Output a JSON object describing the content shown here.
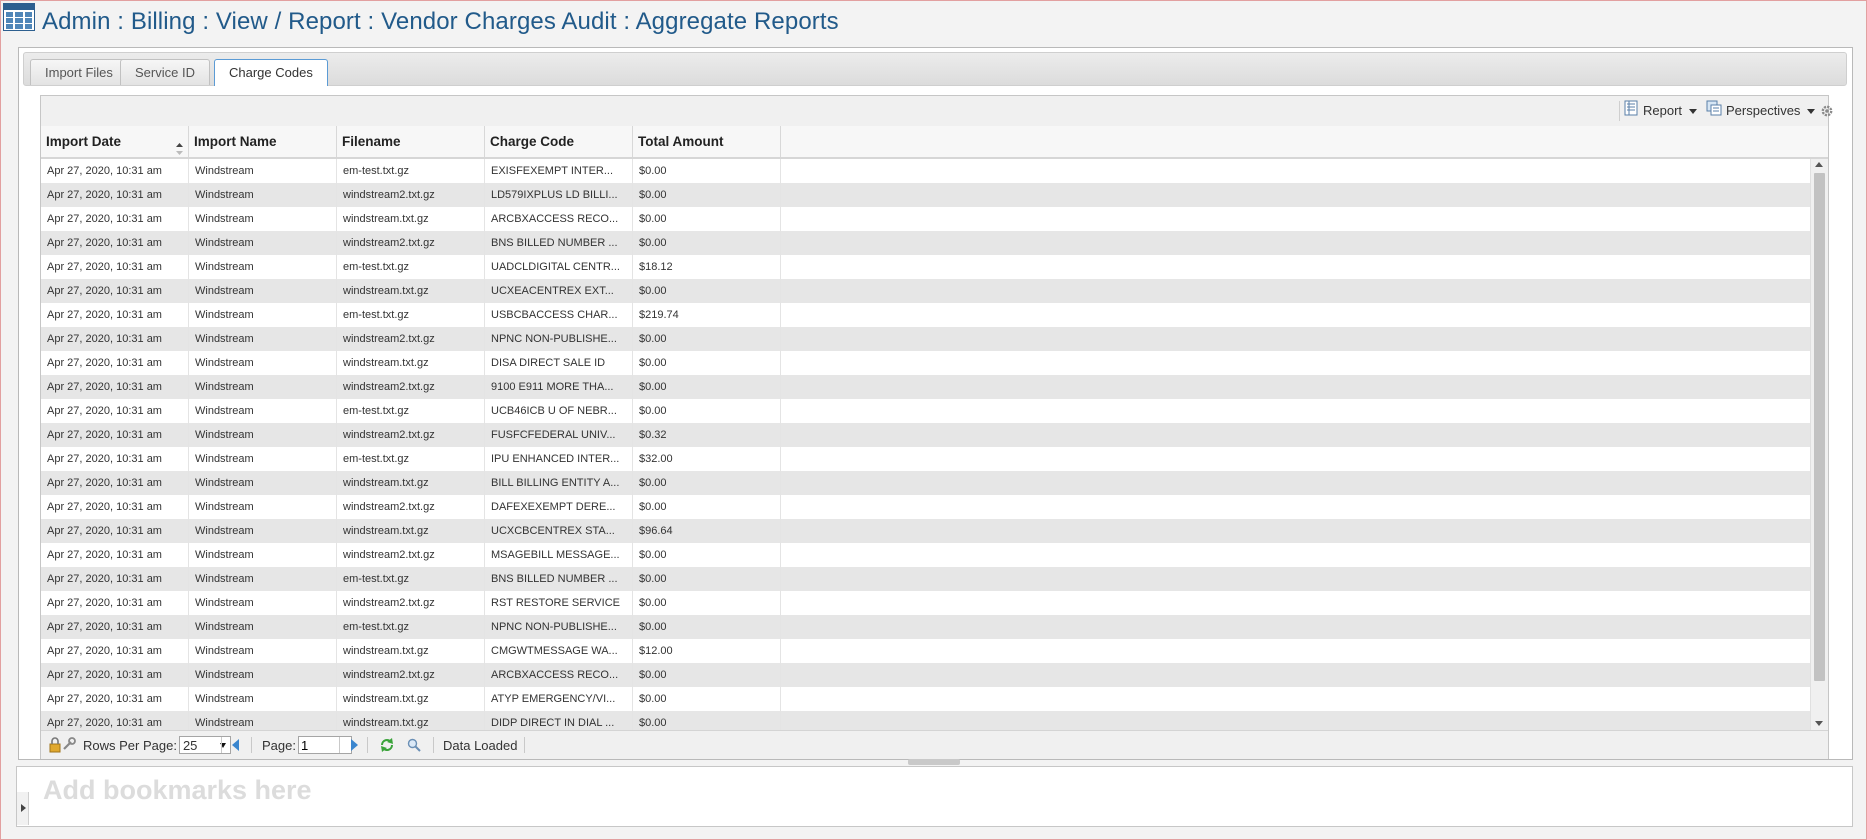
{
  "page_title": "Admin : Billing : View / Report : Vendor Charges Audit : Aggregate Reports",
  "tabs": [
    {
      "label": "Import Files",
      "active": false
    },
    {
      "label": "Service ID",
      "active": false
    },
    {
      "label": "Charge Codes",
      "active": true
    }
  ],
  "toolbar": {
    "report_label": "Report",
    "perspectives_label": "Perspectives"
  },
  "columns": [
    "Import Date",
    "Import Name",
    "Filename",
    "Charge Code",
    "Total Amount"
  ],
  "sorted_column": "Import Date",
  "rows": [
    [
      "Apr 27, 2020, 10:31 am",
      "Windstream",
      "em-test.txt.gz",
      "EXISFEXEMPT INTER...",
      "$0.00"
    ],
    [
      "Apr 27, 2020, 10:31 am",
      "Windstream",
      "windstream2.txt.gz",
      "LD579IXPLUS LD BILLI...",
      "$0.00"
    ],
    [
      "Apr 27, 2020, 10:31 am",
      "Windstream",
      "windstream.txt.gz",
      "ARCBXACCESS RECO...",
      "$0.00"
    ],
    [
      "Apr 27, 2020, 10:31 am",
      "Windstream",
      "windstream2.txt.gz",
      "BNS BILLED NUMBER ...",
      "$0.00"
    ],
    [
      "Apr 27, 2020, 10:31 am",
      "Windstream",
      "em-test.txt.gz",
      "UADCLDIGITAL CENTR...",
      "$18.12"
    ],
    [
      "Apr 27, 2020, 10:31 am",
      "Windstream",
      "windstream.txt.gz",
      "UCXEACENTREX EXT...",
      "$0.00"
    ],
    [
      "Apr 27, 2020, 10:31 am",
      "Windstream",
      "em-test.txt.gz",
      "USBCBACCESS CHAR...",
      "$219.74"
    ],
    [
      "Apr 27, 2020, 10:31 am",
      "Windstream",
      "windstream2.txt.gz",
      "NPNC NON-PUBLISHE...",
      "$0.00"
    ],
    [
      "Apr 27, 2020, 10:31 am",
      "Windstream",
      "windstream.txt.gz",
      "DISA DIRECT SALE ID",
      "$0.00"
    ],
    [
      "Apr 27, 2020, 10:31 am",
      "Windstream",
      "windstream2.txt.gz",
      "9100 E911 MORE THA...",
      "$0.00"
    ],
    [
      "Apr 27, 2020, 10:31 am",
      "Windstream",
      "em-test.txt.gz",
      "UCB46ICB U OF NEBR...",
      "$0.00"
    ],
    [
      "Apr 27, 2020, 10:31 am",
      "Windstream",
      "windstream2.txt.gz",
      "FUSFCFEDERAL UNIV...",
      "$0.32"
    ],
    [
      "Apr 27, 2020, 10:31 am",
      "Windstream",
      "em-test.txt.gz",
      "IPU ENHANCED INTER...",
      "$32.00"
    ],
    [
      "Apr 27, 2020, 10:31 am",
      "Windstream",
      "windstream.txt.gz",
      "BILL BILLING ENTITY A...",
      "$0.00"
    ],
    [
      "Apr 27, 2020, 10:31 am",
      "Windstream",
      "windstream2.txt.gz",
      "DAFEXEXEMPT DERE...",
      "$0.00"
    ],
    [
      "Apr 27, 2020, 10:31 am",
      "Windstream",
      "windstream.txt.gz",
      "UCXCBCENTREX STA...",
      "$96.64"
    ],
    [
      "Apr 27, 2020, 10:31 am",
      "Windstream",
      "windstream2.txt.gz",
      "MSAGEBILL MESSAGE...",
      "$0.00"
    ],
    [
      "Apr 27, 2020, 10:31 am",
      "Windstream",
      "em-test.txt.gz",
      "BNS BILLED NUMBER ...",
      "$0.00"
    ],
    [
      "Apr 27, 2020, 10:31 am",
      "Windstream",
      "windstream2.txt.gz",
      "RST RESTORE SERVICE",
      "$0.00"
    ],
    [
      "Apr 27, 2020, 10:31 am",
      "Windstream",
      "em-test.txt.gz",
      "NPNC NON-PUBLISHE...",
      "$0.00"
    ],
    [
      "Apr 27, 2020, 10:31 am",
      "Windstream",
      "windstream.txt.gz",
      "CMGWTMESSAGE WA...",
      "$12.00"
    ],
    [
      "Apr 27, 2020, 10:31 am",
      "Windstream",
      "windstream2.txt.gz",
      "ARCBXACCESS RECO...",
      "$0.00"
    ],
    [
      "Apr 27, 2020, 10:31 am",
      "Windstream",
      "windstream.txt.gz",
      "ATYP EMERGENCY/VI...",
      "$0.00"
    ],
    [
      "Apr 27, 2020, 10:31 am",
      "Windstream",
      "windstream.txt.gz",
      "DIDP DIRECT IN DIAL ...",
      "$0.00"
    ]
  ],
  "pager": {
    "rows_per_page_label": "Rows Per Page:",
    "rows_per_page_value": "25",
    "page_label": "Page:",
    "page_value": "1",
    "status": "Data Loaded"
  },
  "bookmarks": {
    "placeholder": "Add bookmarks here"
  },
  "icons": {
    "app": "grid-table-icon",
    "report": "report-icon",
    "perspectives": "perspectives-icon",
    "settings": "gear-icon",
    "lock": "lock-icon",
    "prev": "prev-page-icon",
    "next": "next-page-icon",
    "refresh": "refresh-icon",
    "search": "search-icon"
  },
  "colors": {
    "title": "#215a8a",
    "active_tab_border": "#5b9bd5",
    "row_alt": "#e6e6e6"
  }
}
